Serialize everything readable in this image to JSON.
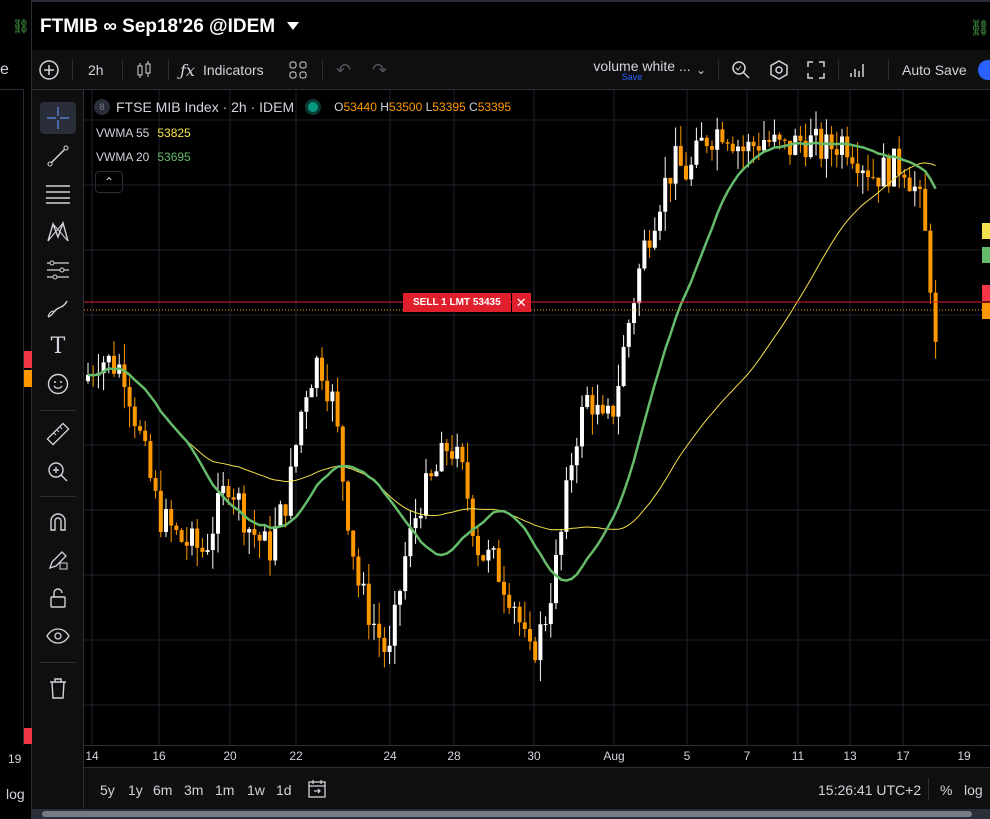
{
  "window": {
    "symbol_title": "FTMIB ∞ Sep18'26 @IDEM"
  },
  "left_pane": {
    "partial_label": "e",
    "date_tick": "19",
    "scale_label": "log"
  },
  "toolbar": {
    "interval": "2h",
    "indicators_label": "Indicators",
    "layout_name": "volume white ...",
    "layout_save": "Save",
    "autosave_label": "Auto Save"
  },
  "legend": {
    "badge": "8",
    "instrument": "FTSE MIB Index · 2h · IDEM",
    "ohlc": {
      "o_label": "O",
      "o_value": "53440",
      "h_label": "H",
      "h_value": "53500",
      "l_label": "L",
      "l_value": "53395",
      "c_label": "C",
      "c_value": "53395"
    },
    "indicators": [
      {
        "name": "VWMA 55",
        "value": "53825",
        "color": "#f5e14b"
      },
      {
        "name": "VWMA 20",
        "value": "53695",
        "color": "#4caf50"
      }
    ],
    "collapse_glyph": "⌃"
  },
  "order": {
    "label": "SELL 1 LMT 53435",
    "close_glyph": "✕"
  },
  "colors": {
    "up_candle": "#ffffff",
    "down_candle": "#ff9800",
    "vwma20": "#66bb6a",
    "vwma55": "#f5e14b",
    "order_line": "#e0202c",
    "last_price_line": "#ff9800",
    "accent": "#2962ff"
  },
  "time_axis": {
    "ticks": [
      "14",
      "16",
      "20",
      "22",
      "24",
      "28",
      "30",
      "Aug",
      "5",
      "7",
      "11",
      "13",
      "17",
      "19"
    ]
  },
  "bottom_bar": {
    "ranges": [
      "5y",
      "1y",
      "6m",
      "3m",
      "1m",
      "1w",
      "1d"
    ],
    "clock": "15:26:41 UTC+2",
    "percent_label": "%",
    "log_label": "log"
  },
  "chart_data": {
    "type": "candlestick",
    "interval": "2h",
    "y_range_approx": [
      52200,
      54900
    ],
    "vwma_20_last": 53695,
    "vwma_55_last": 53825,
    "last": {
      "open": 53440,
      "high": 53500,
      "low": 53395,
      "close": 53395
    },
    "sell_limit_price": 53435
  }
}
